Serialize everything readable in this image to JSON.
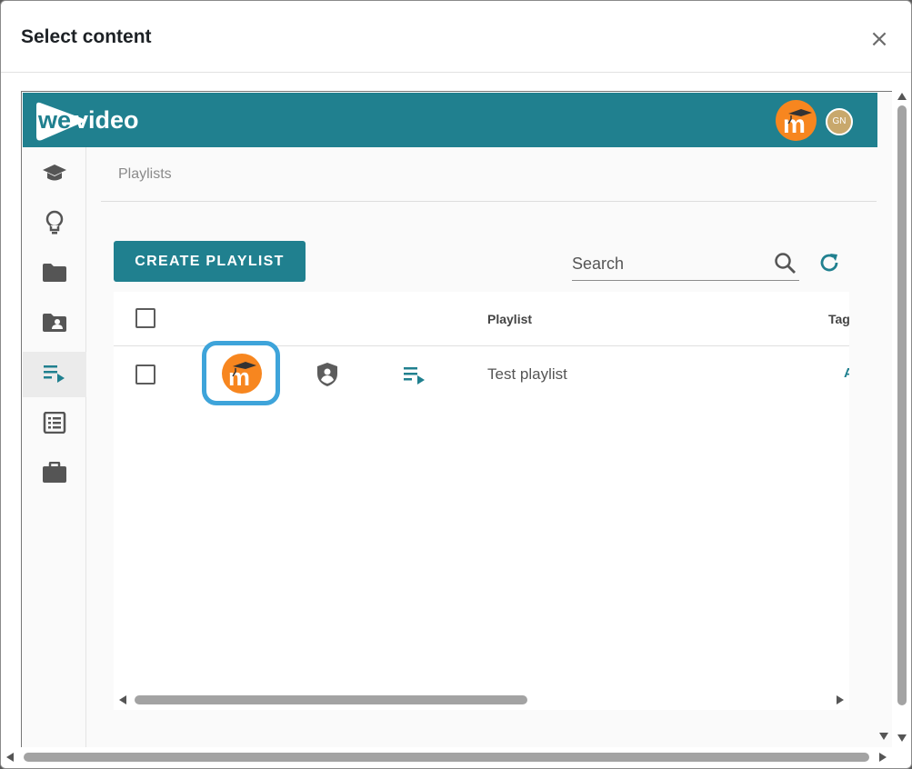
{
  "dialog": {
    "title": "Select content",
    "close_label": "×"
  },
  "app": {
    "brand": "wevideo",
    "accent_color": "#20808f",
    "moodle_color": "#f7861f",
    "user_initials": "GN"
  },
  "sidebar": {
    "items": [
      {
        "icon": "graduation-cap-icon"
      },
      {
        "icon": "lightbulb-icon"
      },
      {
        "icon": "folder-icon"
      },
      {
        "icon": "shared-folder-icon"
      },
      {
        "icon": "playlist-icon",
        "active": true
      },
      {
        "icon": "list-icon"
      },
      {
        "icon": "briefcase-icon"
      }
    ]
  },
  "breadcrumb": "Playlists",
  "toolbar": {
    "create_label": "CREATE PLAYLIST",
    "search_placeholder": "Search"
  },
  "table": {
    "columns": [
      "Playlist",
      "Tag"
    ],
    "rows": [
      {
        "name": "Test playlist",
        "tag": "A"
      }
    ]
  }
}
